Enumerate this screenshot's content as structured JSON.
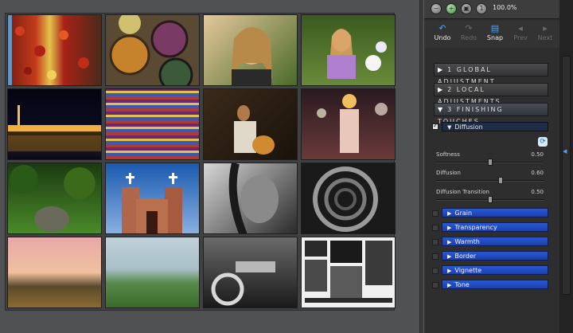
{
  "toolbar": {
    "zoom_label": "100.0%",
    "icons": [
      "zoom-out-icon",
      "zoom-in-icon",
      "fit-icon",
      "one-to-one-icon"
    ]
  },
  "edit": {
    "undo": "Undo",
    "redo": "Redo",
    "snap": "Snap",
    "prev": "Prev",
    "next": "Next"
  },
  "sections": {
    "global": "1 GLOBAL ADJUSTMENT",
    "local": "2 LOCAL ADJUSTMENTS",
    "finishing": "3 FINISHING TOUCHES"
  },
  "diffusion": {
    "title": "Diffusion",
    "enabled": true,
    "sliders": [
      {
        "label": "Softness",
        "value": "0.50",
        "fraction": 0.5
      },
      {
        "label": "Diffusion",
        "value": "0.60",
        "fraction": 0.6
      },
      {
        "label": "Diffusion Transition",
        "value": "0.50",
        "fraction": 0.5
      }
    ]
  },
  "effects": [
    "Grain",
    "Transparency",
    "Warmth",
    "Border",
    "Vignette",
    "Tone"
  ],
  "thumbnails": [
    "peppers",
    "pottery",
    "woman-portrait",
    "girl-flowers",
    "city-night",
    "textiles",
    "guitarist",
    "chandelier",
    "garden",
    "church",
    "face-bw",
    "spiral-stairs",
    "sunset-hills",
    "rolling-hills",
    "motorcycle-bw",
    "contact-sheet"
  ],
  "colors": {
    "accent": "#1f4cc8",
    "panel": "#2e2e2f",
    "canvas": "#505152"
  }
}
